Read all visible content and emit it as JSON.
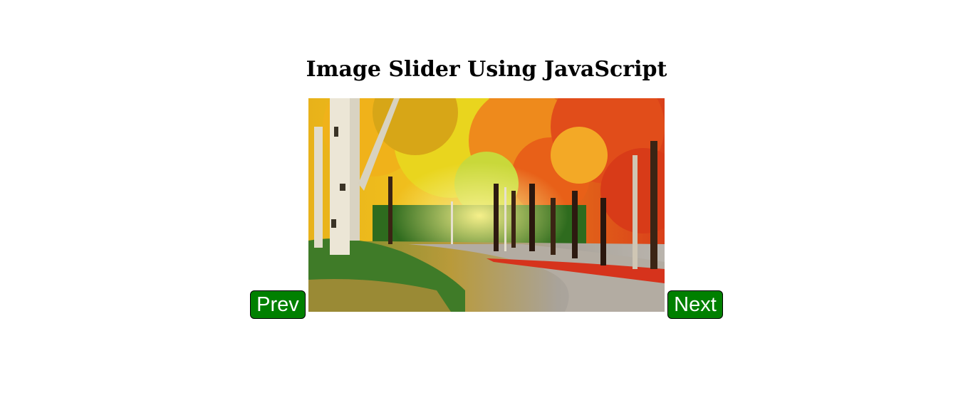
{
  "heading": "Image Slider Using JavaScript",
  "slider": {
    "image_alt": "",
    "prev_label": "Prev",
    "next_label": "Next",
    "button_color": "#008000"
  }
}
